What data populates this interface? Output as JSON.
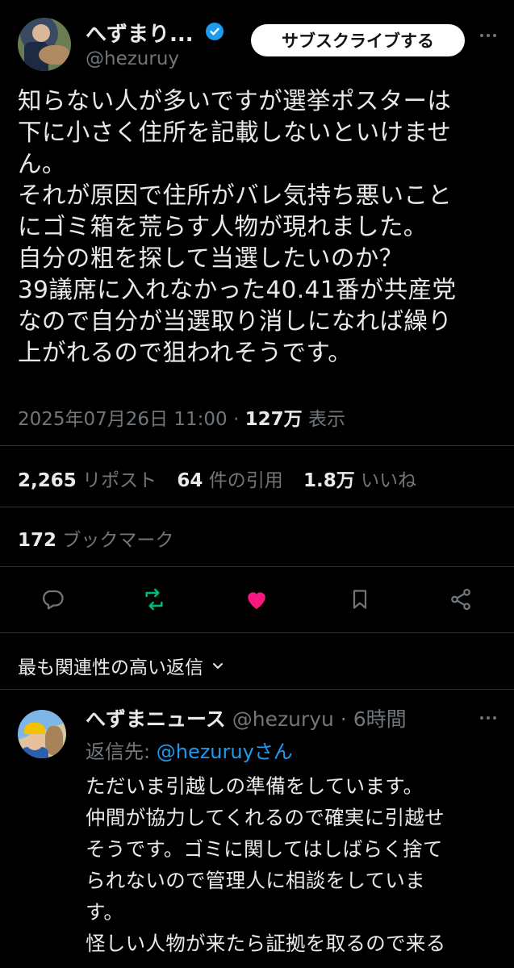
{
  "author": {
    "display_name": "へずまり...",
    "handle": "@hezuruy",
    "verified_icon": "verified-badge-icon"
  },
  "subscribe_label": "サブスクライブする",
  "tweet": {
    "lines": [
      "知らない人が多いですが選挙ポスターは",
      "下に小さく住所を記載しないといけませ",
      "ん。",
      "それが原因で住所がバレ気持ち悪いこと",
      "にゴミ箱を荒らす人物が現れました。",
      "自分の粗を探して当選したいのか？",
      "39議席に入れなかった40.41番が共産党",
      "なので自分が当選取り消しになれば繰り",
      "上がれるので狙われそうです。"
    ],
    "timestamp": "2025年07月26日 11:00",
    "separator": "·",
    "views_count": "127万",
    "views_label": "表示"
  },
  "stats": {
    "reposts_count": "2,265",
    "reposts_label": "リポスト",
    "quotes_count": "64",
    "quotes_label": "件の引用",
    "likes_count": "1.8万",
    "likes_label": "いいね",
    "bookmarks_count": "172",
    "bookmarks_label": "ブックマーク"
  },
  "actions": [
    "reply-icon",
    "repost-icon",
    "like-icon",
    "bookmark-icon",
    "share-icon"
  ],
  "colors": {
    "background": "#000000",
    "text": "#e7e9ea",
    "muted": "#71767b",
    "accent": "#1d9bf0",
    "repost": "#00ba7c",
    "like": "#f91880"
  },
  "sort_label": "最も関連性の高い返信",
  "reply": {
    "display_name": "へずまニュース",
    "handle": "@hezuryu",
    "separator": "·",
    "time": "6時間",
    "reply_to_label": "返信先:",
    "reply_to_handle": "@hezuruyさん",
    "lines": [
      "ただいま引越しの準備をしています。",
      "仲間が協力してくれるので確実に引越せ",
      "そうです。ゴミに関してはしばらく捨て",
      "られないので管理人に相談をしていま",
      "す。",
      "怪しい人物が来たら証拠を取るので来る"
    ]
  }
}
